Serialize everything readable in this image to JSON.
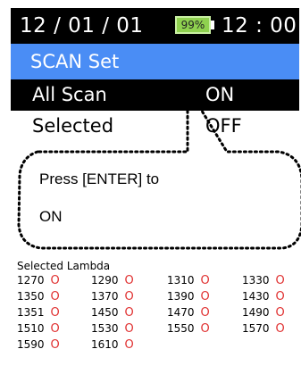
{
  "status": {
    "date": "12 / 01 / 01",
    "battery": "99%",
    "time": "12 : 00"
  },
  "menu": {
    "title": "SCAN Set",
    "rows": [
      {
        "label": "All Scan",
        "value": "ON",
        "highlighted": true
      },
      {
        "label": "Selected",
        "value": "OFF",
        "highlighted": false
      }
    ]
  },
  "callout": {
    "line1": "Press [ENTER] to",
    "line2": "ON"
  },
  "lambda": {
    "title": "Selected Lambda",
    "mark": "O",
    "rows": [
      [
        "1270",
        "1290",
        "1310",
        "1330"
      ],
      [
        "1350",
        "1370",
        "1390",
        "1430"
      ],
      [
        "1351",
        "1450",
        "1470",
        "1490"
      ],
      [
        "1510",
        "1530",
        "1550",
        "1570"
      ],
      [
        "1590",
        "1610"
      ]
    ]
  },
  "colors": {
    "title_bar": "#4a8df5",
    "battery": "#8fd14f",
    "mark": "#e03030"
  }
}
